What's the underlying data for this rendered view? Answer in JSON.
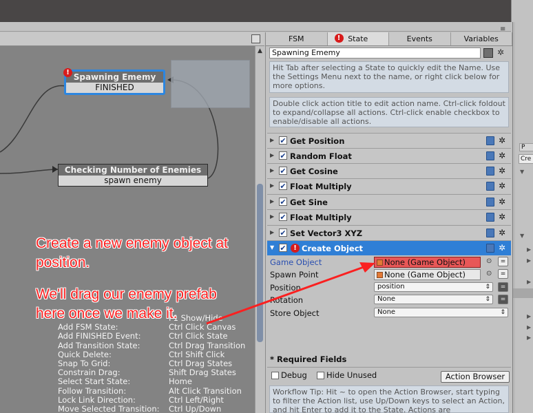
{
  "graph": {
    "nodes": [
      {
        "title": "Spawning Ememy",
        "subtitle": "FINISHED"
      },
      {
        "title": "Checking Number of Enemies",
        "subtitle": "spawn enemy"
      }
    ],
    "hints": [
      {
        "k": "Add FSM State:",
        "v": "Ctrl Click Canvas"
      },
      {
        "k": "Add FINISHED Event:",
        "v": "Ctrl Click State"
      },
      {
        "k": "Add Transition State:",
        "v": "Ctrl Drag Transition"
      },
      {
        "k": "Quick Delete:",
        "v": "Ctrl Shift Click"
      },
      {
        "k": "Snap To Grid:",
        "v": "Ctrl Drag States"
      },
      {
        "k": "Constrain Drag:",
        "v": "Shift Drag States"
      },
      {
        "k": "Select Start State:",
        "v": "Home"
      },
      {
        "k": "Follow Transition:",
        "v": "Alt Click Transition"
      },
      {
        "k": "Lock Link Direction:",
        "v": "Ctrl Left/Right"
      },
      {
        "k": "Move Selected Transition:",
        "v": "Ctrl Up/Down"
      }
    ],
    "hidden_hint": "F1 Show/Hide"
  },
  "annotation": {
    "line1": "Create a new enemy object at position.",
    "line2": "We'll drag our enemy prefab here once we make it."
  },
  "panel": {
    "tabs": [
      "FSM",
      "State",
      "Events",
      "Variables"
    ],
    "state_name": "Spawning Ememy",
    "help1": "Hit Tab after selecting a State to quickly edit the Name. Use the Settings Menu next to the name, or right click below for more options.",
    "help2": "Double click action title to edit action name. Ctrl-click foldout to expand/collapse all actions. Ctrl-click enable checkbox to enable/disable all actions.",
    "actions": [
      "Get Position",
      "Random Float",
      "Get Cosine",
      "Float Multiply",
      "Get Sine",
      "Float Multiply",
      "Set Vector3 XYZ"
    ],
    "selected_action": "Create Object",
    "props": {
      "game_object_label": "Game Object",
      "game_object_value": "None (Game Object)",
      "spawn_point_label": "Spawn Point",
      "spawn_point_value": "None (Game Object)",
      "position_label": "Position",
      "position_value": "position",
      "rotation_label": "Rotation",
      "rotation_value": "None",
      "store_label": "Store Object",
      "store_value": "None"
    },
    "required_fields": "* Required Fields",
    "debug": "Debug",
    "hide_unused": "Hide Unused",
    "action_browser": "Action Browser",
    "tip": "Workflow Tip: Hit ~ to open the Action Browser, start typing to filter the Action list, use Up/Down keys to select an Action, and hit Enter to add it to the State. Actions are"
  },
  "far_right": {
    "tab_label": "P",
    "create_label": "Cre"
  },
  "colors": {
    "selected_blue": "#2f7fd6",
    "error_red": "#d81b1b",
    "annotation_red": "#fa2020"
  }
}
